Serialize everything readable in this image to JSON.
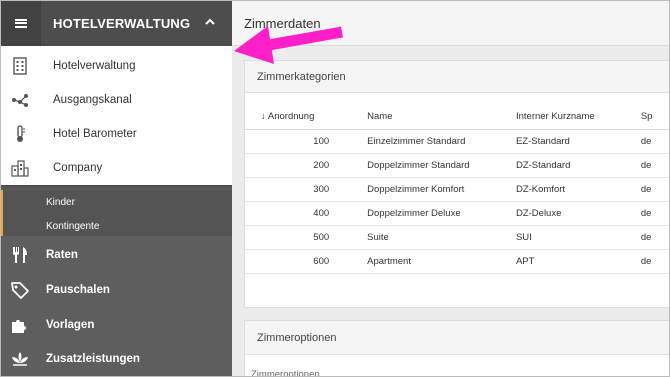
{
  "sidebar": {
    "title": "HOTELVERWALTUNG",
    "dropdown_items": [
      {
        "label": "Hotelverwaltung",
        "icon": "building-icon"
      },
      {
        "label": "Ausgangskanal",
        "icon": "share-nodes-icon"
      },
      {
        "label": "Hotel Barometer",
        "icon": "thermometer-icon"
      },
      {
        "label": "Company",
        "icon": "city-icon"
      }
    ],
    "sub_items": [
      "Kinder",
      "Kontingente"
    ],
    "nav_items": [
      {
        "label": "Raten",
        "icon": "cutlery-icon"
      },
      {
        "label": "Pauschalen",
        "icon": "tag-icon"
      },
      {
        "label": "Vorlagen",
        "icon": "puzzle-icon"
      },
      {
        "label": "Zusatzleistungen",
        "icon": "lotus-icon"
      }
    ]
  },
  "main": {
    "title": "Zimmerdaten",
    "categories_card": {
      "title": "Zimmerkategorien",
      "columns": [
        "Anordnung",
        "Name",
        "Interner Kurzname",
        "Sp"
      ],
      "rows": [
        {
          "order": "100",
          "name": "Einzelzimmer Standard",
          "short": "EZ-Standard",
          "lang": "de"
        },
        {
          "order": "200",
          "name": "Doppelzimmer Standard",
          "short": "DZ-Standard",
          "lang": "de"
        },
        {
          "order": "300",
          "name": "Doppelzimmer Komfort",
          "short": "DZ-Komfort",
          "lang": "de"
        },
        {
          "order": "400",
          "name": "Doppelzimmer Deluxe",
          "short": "DZ-Deluxe",
          "lang": "de"
        },
        {
          "order": "500",
          "name": "Suite",
          "short": "SUI",
          "lang": "de"
        },
        {
          "order": "600",
          "name": "Apartment",
          "short": "APT",
          "lang": "de"
        }
      ]
    },
    "options_card": {
      "title": "Zimmeroptionen",
      "subtitle": "Zimmeroptionen"
    }
  },
  "colors": {
    "sidebar_bg": "#5e5e5e",
    "accent": "#f0a431",
    "annotation_arrow": "#ff1fc8"
  }
}
